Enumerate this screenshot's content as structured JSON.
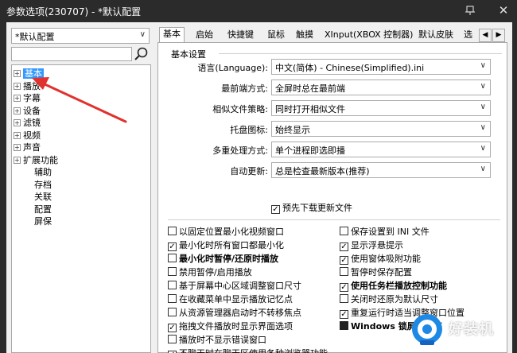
{
  "window": {
    "title": "参数选项(230707) - *默认配置",
    "close_glyph": "✕"
  },
  "left": {
    "profile_select": "*默认配置",
    "search_placeholder": "",
    "tree": [
      {
        "label": "基本",
        "expandable": true,
        "selected": true
      },
      {
        "label": "播放",
        "expandable": true,
        "selected": false
      },
      {
        "label": "字幕",
        "expandable": true,
        "selected": false
      },
      {
        "label": "设备",
        "expandable": true,
        "selected": false
      },
      {
        "label": "滤镜",
        "expandable": true,
        "selected": false
      },
      {
        "label": "视频",
        "expandable": true,
        "selected": false
      },
      {
        "label": "声音",
        "expandable": true,
        "selected": false
      },
      {
        "label": "扩展功能",
        "expandable": true,
        "selected": false
      },
      {
        "label": "辅助",
        "expandable": false,
        "selected": false
      },
      {
        "label": "存档",
        "expandable": false,
        "selected": false
      },
      {
        "label": "关联",
        "expandable": false,
        "selected": false
      },
      {
        "label": "配置",
        "expandable": false,
        "selected": false
      },
      {
        "label": "屏保",
        "expandable": false,
        "selected": false
      }
    ],
    "expand_glyph": "+"
  },
  "tabs": {
    "items": [
      "基本",
      "启始",
      "快捷键",
      "鼠标",
      "触摸",
      "XInput(XBOX 控制器)",
      "默认皮肤",
      "选"
    ],
    "active_index": 0,
    "scroll_left": "◀",
    "scroll_right": "▶"
  },
  "settings": {
    "group_title": "基本设置",
    "rows": [
      {
        "label": "语言(Language):",
        "value": "中文(简体) - Chinese(Simplified).ini"
      },
      {
        "label": "最前端方式:",
        "value": "全屏时总在最前端"
      },
      {
        "label": "相似文件策略:",
        "value": "同时打开相似文件"
      },
      {
        "label": "托盘图标:",
        "value": "始终显示"
      },
      {
        "label": "多重处理方式:",
        "value": "单个进程即选即播"
      },
      {
        "label": "自动更新:",
        "value": "总是检查最新版本(推荐)"
      }
    ],
    "predownload": {
      "label": "预先下载更新文件",
      "checked": true
    },
    "dropdown_glyph": "∨"
  },
  "options_left": [
    {
      "label": "以固定位置最小化视频窗口",
      "checked": false,
      "bold": false
    },
    {
      "label": "最小化时所有窗口都最小化",
      "checked": true,
      "bold": false
    },
    {
      "label": "最小化时暂停/还原时播放",
      "checked": false,
      "bold": true
    },
    {
      "label": "禁用暂停/启用播放",
      "checked": false,
      "bold": false
    },
    {
      "label": "基于屏幕中心区域调整窗口尺寸",
      "checked": false,
      "bold": false
    },
    {
      "label": "在收藏菜单中显示播放记忆点",
      "checked": false,
      "bold": false
    },
    {
      "label": "从资源管理器启动时不转移焦点",
      "checked": false,
      "bold": false
    },
    {
      "label": "拖拽文件播放时显示界面选项",
      "checked": true,
      "bold": false
    },
    {
      "label": "播放时不显示错误窗口",
      "checked": false,
      "bold": false
    },
    {
      "label": "不聊天时在聊天区使用各种浏览器功能",
      "checked": true,
      "bold": false
    }
  ],
  "options_right": [
    {
      "label": "保存设置到 INI 文件",
      "checked": false,
      "bold": false
    },
    {
      "label": "显示浮悬提示",
      "checked": true,
      "bold": false
    },
    {
      "label": "使用窗体吸附功能",
      "checked": true,
      "bold": false
    },
    {
      "label": "暂停时保存配置",
      "checked": false,
      "bold": false
    },
    {
      "label": "使用任务栏播放控制功能",
      "checked": true,
      "bold": true
    },
    {
      "label": "关闭时还原为默认尺寸",
      "checked": false,
      "bold": false
    },
    {
      "label": "重复运行时适当调整窗口位置",
      "checked": true,
      "bold": false
    },
    {
      "label": "Windows 锁屏时暂停",
      "checked": false,
      "bold": true,
      "filled": true
    }
  ],
  "check_glyph": "✓",
  "watermark": {
    "text": "好装机"
  },
  "colors": {
    "selection": "#3399ff",
    "annotation_arrow": "#e0322e",
    "titlebar": "#2b2b2b"
  }
}
